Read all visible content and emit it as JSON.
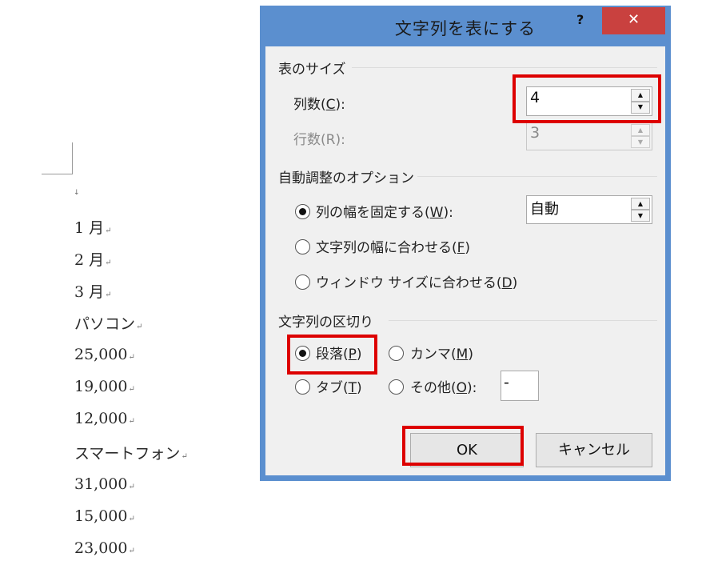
{
  "document": {
    "lines": [
      "1 月",
      "2 月",
      "3 月",
      "パソコン",
      "25,000",
      "19,000",
      "12,000",
      "スマートフォン",
      "31,000",
      "15,000",
      "23,000"
    ],
    "paragraph_mark": "↵",
    "empty_paragraph_mark": "↓"
  },
  "dialog": {
    "title": "文字列を表にする",
    "help_label": "?",
    "close_label": "✕",
    "table_size": {
      "section_label": "表のサイズ",
      "columns_label_pre": "列数(",
      "columns_accel": "C",
      "columns_label_post": "):",
      "columns_value": "4",
      "rows_label": "行数(R):",
      "rows_value": "3"
    },
    "autofit": {
      "section_label": "自動調整のオプション",
      "fixed_pre": "列の幅を固定する(",
      "fixed_accel": "W",
      "fixed_post": "):",
      "fixed_value": "自動",
      "contents_pre": "文字列の幅に合わせる(",
      "contents_accel": "F",
      "contents_post": ")",
      "window_pre": "ウィンドウ サイズに合わせる(",
      "window_accel": "D",
      "window_post": ")",
      "selected": "fixed"
    },
    "separator": {
      "section_label": "文字列の区切り",
      "paragraph_pre": "段落(",
      "paragraph_accel": "P",
      "paragraph_post": ")",
      "comma_pre": "カンマ(",
      "comma_accel": "M",
      "comma_post": ")",
      "tab_pre": "タブ(",
      "tab_accel": "T",
      "tab_post": ")",
      "other_pre": "その他(",
      "other_accel": "O",
      "other_post": "):",
      "other_value": "-",
      "selected": "paragraph"
    },
    "ok_label": "OK",
    "cancel_label": "キャンセル"
  },
  "colors": {
    "title_bar": "#5b8fcf",
    "close_button": "#c9413f",
    "highlight": "#dd0000"
  }
}
